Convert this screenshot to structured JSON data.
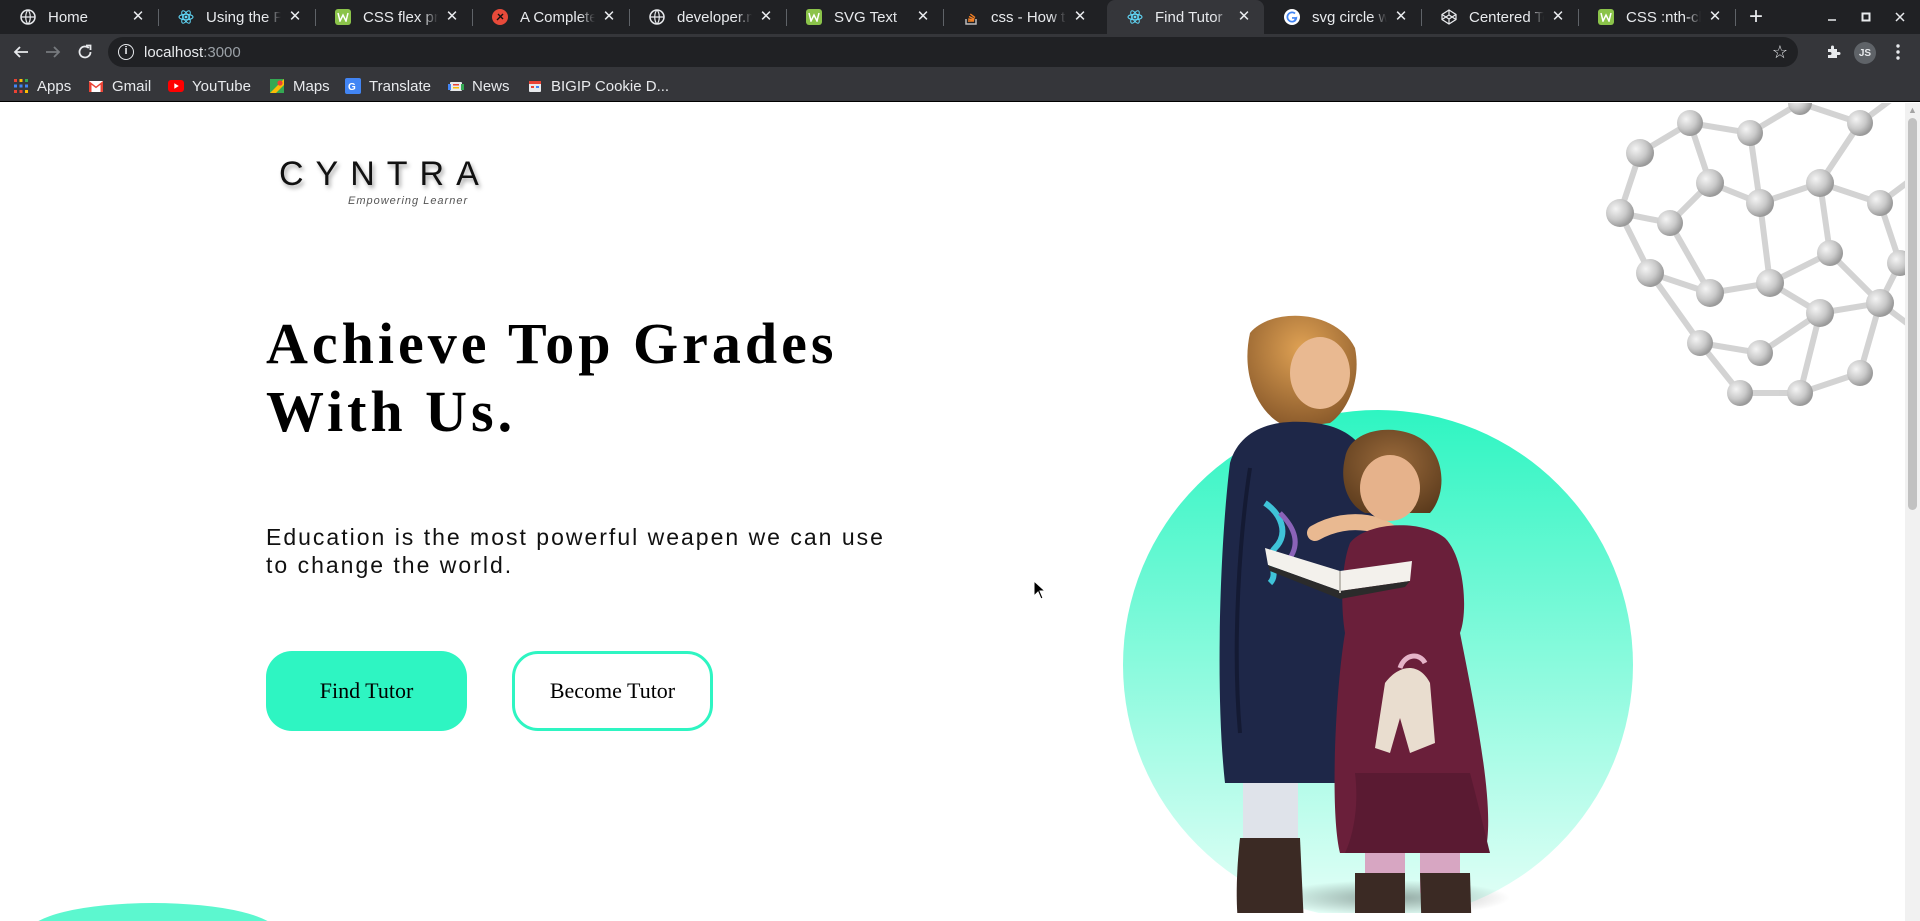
{
  "browser": {
    "tabs": [
      {
        "title": "Home",
        "icon": "globe-icon",
        "active": false
      },
      {
        "title": "Using the Public",
        "icon": "react-icon",
        "active": false
      },
      {
        "title": "CSS flex property",
        "icon": "w3schools-icon",
        "active": false
      },
      {
        "title": "A Complete Guide",
        "icon": "css-tricks-icon",
        "active": false
      },
      {
        "title": "developer.mozilla",
        "icon": "globe-icon",
        "active": false
      },
      {
        "title": "SVG Text",
        "icon": "w3schools-icon",
        "active": false
      },
      {
        "title": "css - How to do",
        "icon": "stackoverflow-icon",
        "active": false
      },
      {
        "title": "Find Tutor",
        "icon": "react-icon",
        "active": true
      },
      {
        "title": "svg circle with",
        "icon": "google-icon",
        "active": false
      },
      {
        "title": "Centered Text",
        "icon": "codepen-icon",
        "active": false
      },
      {
        "title": "CSS :nth-child",
        "icon": "w3schools-icon",
        "active": false
      }
    ],
    "address": {
      "host": "localhost",
      "port": ":3000"
    },
    "profile_initials": "JS",
    "bookmarks": [
      {
        "label": "Apps",
        "icon": "apps-grid-icon"
      },
      {
        "label": "Gmail",
        "icon": "gmail-icon"
      },
      {
        "label": "YouTube",
        "icon": "youtube-icon"
      },
      {
        "label": "Maps",
        "icon": "maps-icon"
      },
      {
        "label": "Translate",
        "icon": "translate-icon"
      },
      {
        "label": "News",
        "icon": "news-icon"
      },
      {
        "label": "BIGIP Cookie D...",
        "icon": "bookmark-icon"
      }
    ]
  },
  "page": {
    "logo": {
      "name": "CYNTRA",
      "tagline": "Empowering Learner"
    },
    "headline": "Achieve Top Grades With Us.",
    "subtext": "Education is the most powerful weapen we can use to change the world.",
    "buttons": {
      "find": "Find Tutor",
      "become": "Become Tutor"
    },
    "colors": {
      "accent": "#2ef5c2",
      "accent_light": "#e0fff6"
    }
  }
}
